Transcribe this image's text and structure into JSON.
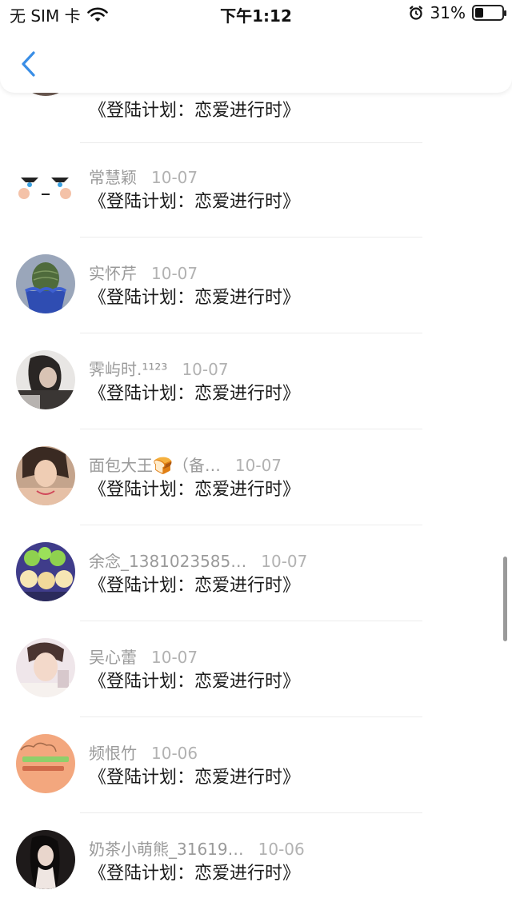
{
  "status_bar": {
    "carrier": "无 SIM 卡",
    "time": "下午1:12",
    "battery": "31%",
    "battery_level": 0.31
  },
  "nav": {
    "back_icon": "chevron-left-icon",
    "accent_color": "#3a8ee6"
  },
  "comments": [
    {
      "name": "",
      "date": "",
      "title": "《登陆计划：恋爱进行时》"
    },
    {
      "name": "常慧颖",
      "date": "10-07",
      "title": "《登陆计划：恋爱进行时》"
    },
    {
      "name": "实怀芹",
      "date": "10-07",
      "title": "《登陆计划：恋爱进行时》"
    },
    {
      "name": "霁屿时.¹¹²³",
      "date": "10-07",
      "title": "《登陆计划：恋爱进行时》"
    },
    {
      "name": "面包大王🍞（备…",
      "date": "10-07",
      "title": "《登陆计划：恋爱进行时》"
    },
    {
      "name": "余念_1381023585…",
      "date": "10-07",
      "title": "《登陆计划：恋爱进行时》"
    },
    {
      "name": "吴心蕾",
      "date": "10-07",
      "title": "《登陆计划：恋爱进行时》"
    },
    {
      "name": "频恨竹",
      "date": "10-06",
      "title": "《登陆计划：恋爱进行时》"
    },
    {
      "name": "奶茶小萌熊_31619…",
      "date": "10-06",
      "title": "《登陆计划：恋爱进行时》"
    }
  ]
}
